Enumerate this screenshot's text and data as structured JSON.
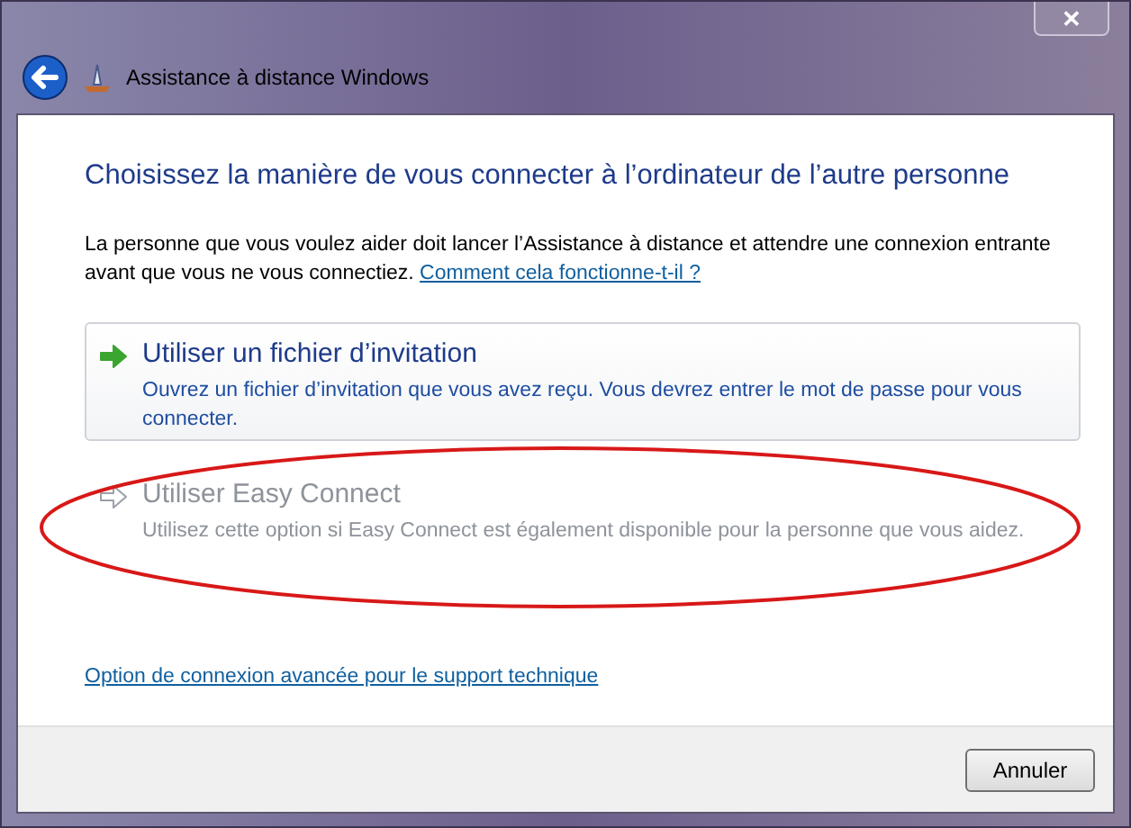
{
  "window": {
    "title": "Assistance à distance Windows",
    "close": "✕"
  },
  "heading": "Choisissez la manière de vous connecter à l’ordinateur de l’autre personne",
  "intro": "La personne que vous voulez aider doit lancer l’Assistance à distance et attendre une connexion entrante avant que vous ne vous connectiez.",
  "intro_link": "Comment cela fonctionne-t-il ?",
  "options": [
    {
      "title": "Utiliser un fichier d’invitation",
      "description": "Ouvrez un fichier d’invitation que vous avez reçu. Vous devrez entrer le mot de passe pour vous connecter.",
      "disabled": false
    },
    {
      "title": "Utiliser Easy Connect",
      "description": "Utilisez cette option si Easy Connect est également disponible pour la personne que vous aidez.",
      "disabled": true
    }
  ],
  "advanced_link": "Option de connexion avancée pour le support technique",
  "buttons": [
    "Annuler"
  ]
}
